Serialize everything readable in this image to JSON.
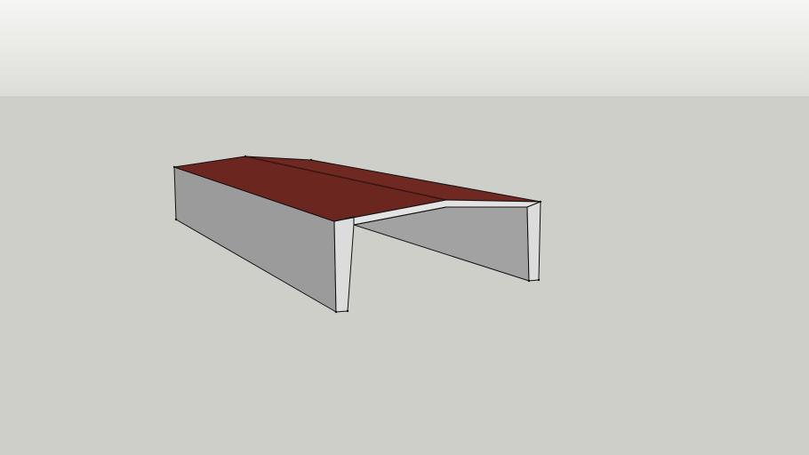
{
  "scene": {
    "sky_top_color": "#f6f6f4",
    "sky_bottom_color": "#dcdcd8",
    "ground_color": "#cfcfca",
    "roof_color": "#6b2620",
    "roof_ridge_line_color": "#3a1513",
    "wall_shadow_color": "#9b9b9b",
    "wall_interior_color": "#a2a2a2",
    "frame_face_color": "#dcdcdc",
    "edge_color": "#111111"
  }
}
